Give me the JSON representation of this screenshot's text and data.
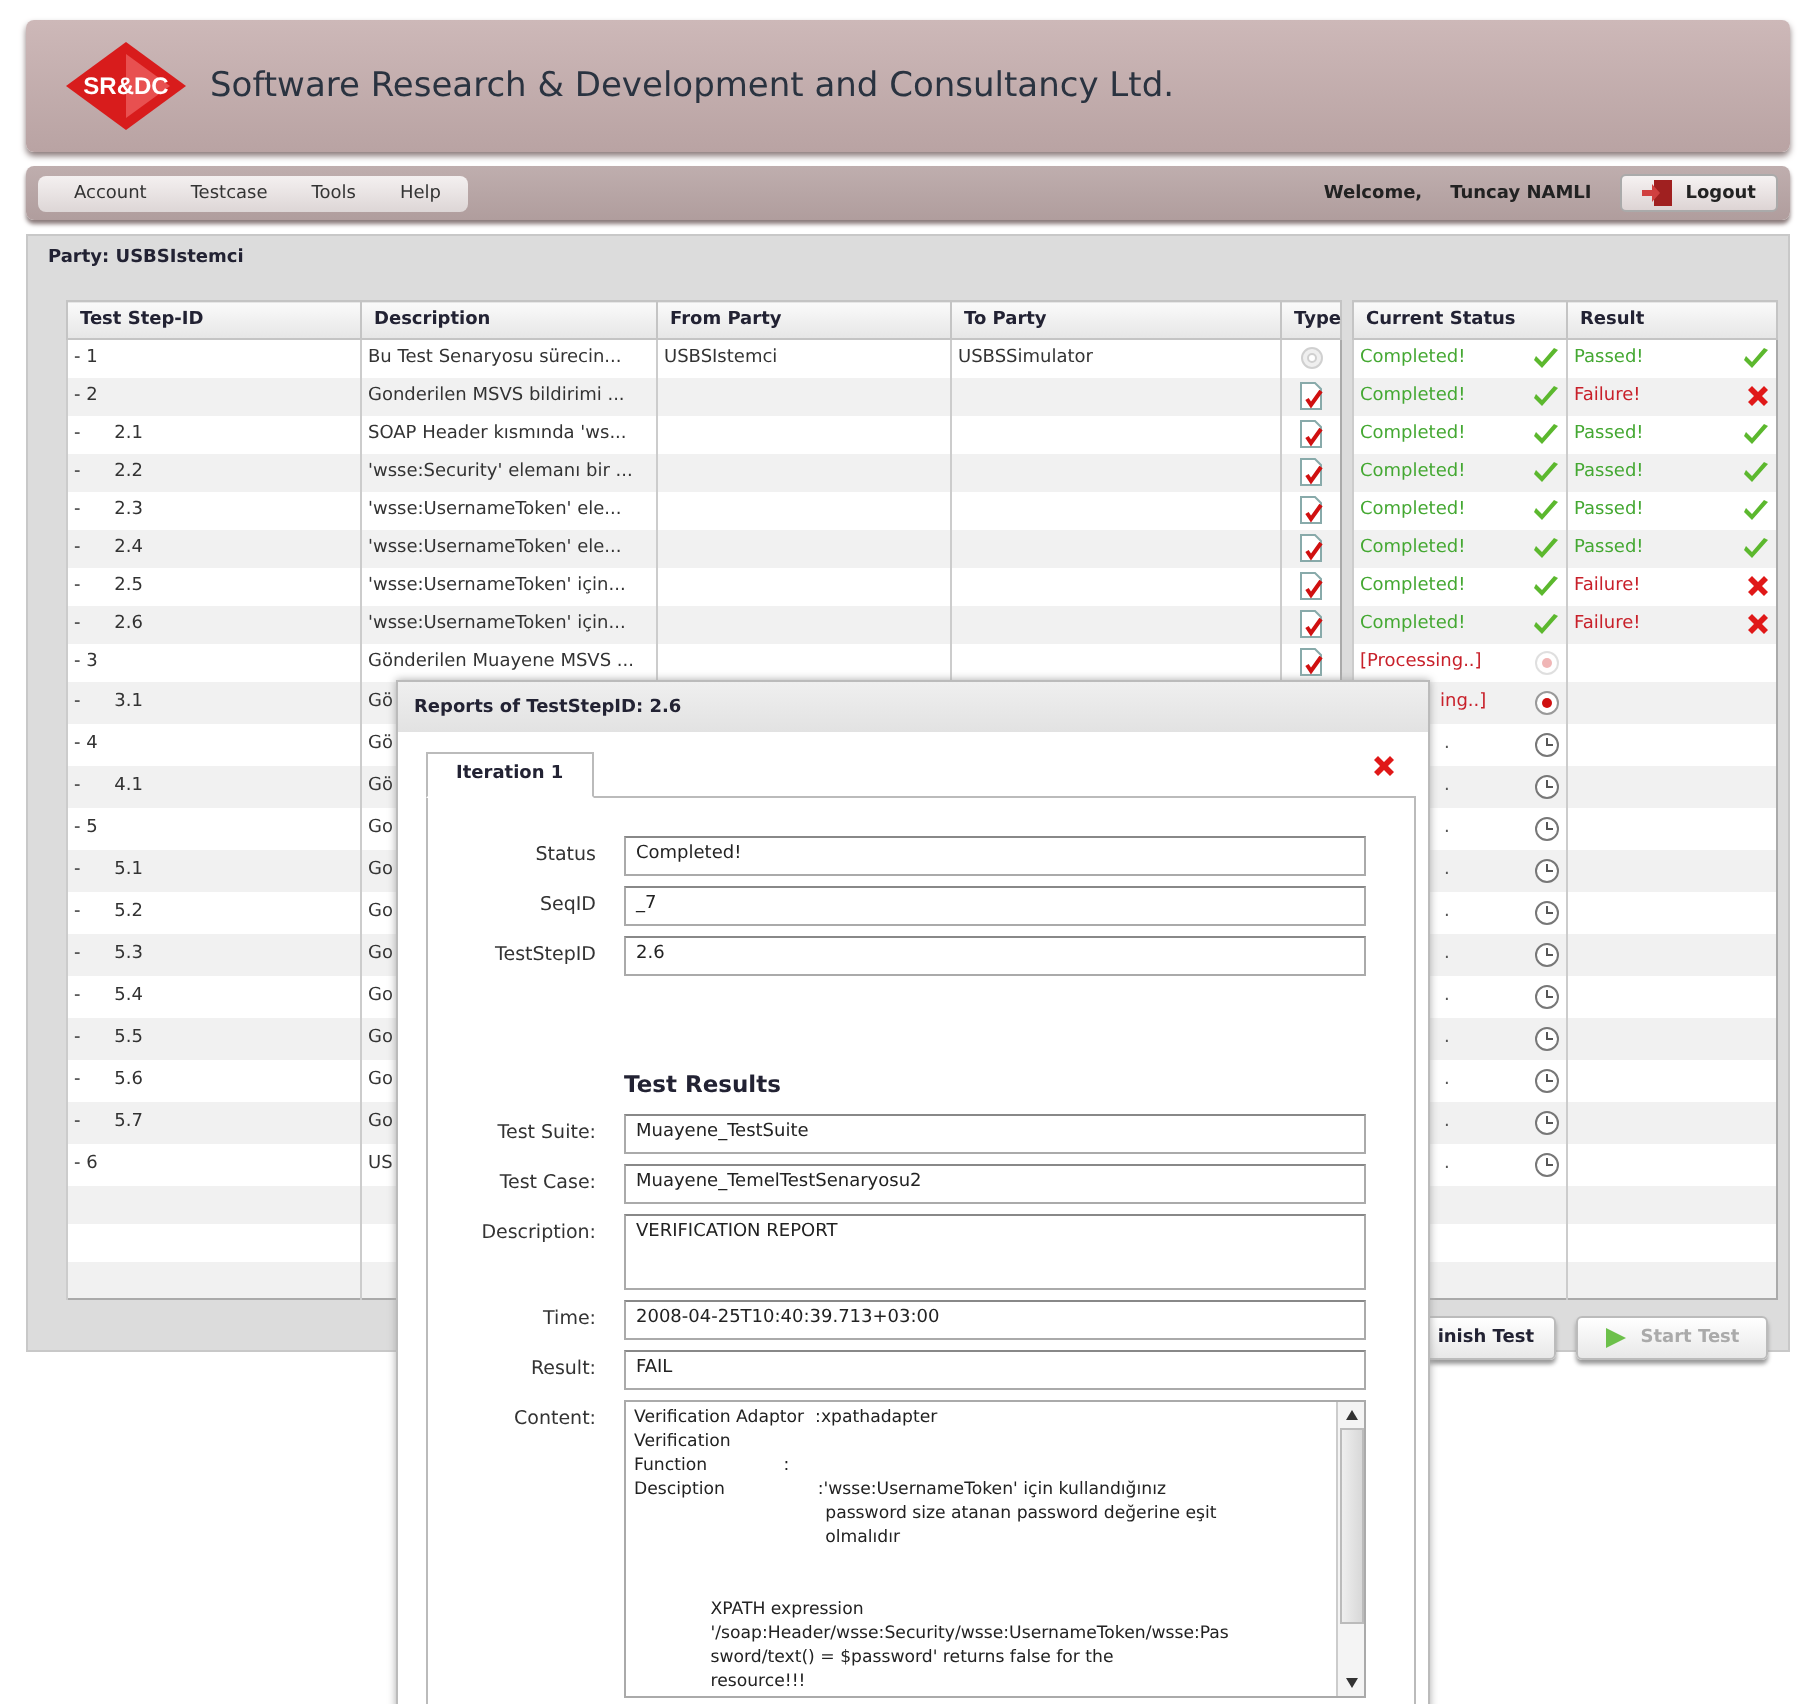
{
  "header": {
    "logo": "SR&DC",
    "title": "Software Research & Development and Consultancy Ltd."
  },
  "menu": [
    "Account",
    "Testcase",
    "Tools",
    "Help"
  ],
  "user": {
    "welcome": "Welcome,",
    "name": "Tuncay NAMLI",
    "logout": "Logout"
  },
  "party": "Party: USBSIstemci",
  "steps_table": {
    "columns": [
      "Test Step-ID",
      "Description",
      "From Party",
      "To Party",
      "Type"
    ],
    "status_columns": [
      "Current Status",
      "Result"
    ],
    "rows": [
      {
        "marker": "-",
        "id": "1",
        "description": "Bu Test Senaryosu sürecin...",
        "from": "USBSIstemci",
        "to": "USBSSimulator",
        "kind": "service",
        "covered": false,
        "status": {
          "text": "Completed!",
          "kind": "completed"
        },
        "result": {
          "text": "Passed!",
          "kind": "passed"
        }
      },
      {
        "marker": "-",
        "id": "2",
        "description": "Gonderilen MSVS bildirimi ...",
        "kind": "document",
        "covered": false,
        "status": {
          "text": "Completed!",
          "kind": "completed"
        },
        "result": {
          "text": "Failure!",
          "kind": "failure"
        },
        "children": [
          {
            "marker": "-",
            "id": "2.1",
            "description": "SOAP Header kısmında 'ws...",
            "kind": "document",
            "covered": false,
            "status": {
              "text": "Completed!",
              "kind": "completed"
            },
            "result": {
              "text": "Passed!",
              "kind": "passed"
            }
          },
          {
            "marker": "-",
            "id": "2.2",
            "description": "'wsse:Security' elemanı bir ...",
            "kind": "document",
            "covered": false,
            "status": {
              "text": "Completed!",
              "kind": "completed"
            },
            "result": {
              "text": "Passed!",
              "kind": "passed"
            }
          },
          {
            "marker": "-",
            "id": "2.3",
            "description": "'wsse:UsernameToken' ele...",
            "kind": "document",
            "covered": false,
            "status": {
              "text": "Completed!",
              "kind": "completed"
            },
            "result": {
              "text": "Passed!",
              "kind": "passed"
            }
          },
          {
            "marker": "-",
            "id": "2.4",
            "description": "'wsse:UsernameToken' ele...",
            "kind": "document",
            "covered": false,
            "status": {
              "text": "Completed!",
              "kind": "completed"
            },
            "result": {
              "text": "Passed!",
              "kind": "passed"
            }
          },
          {
            "marker": "-",
            "id": "2.5",
            "description": "'wsse:UsernameToken' için...",
            "kind": "document",
            "covered": false,
            "status": {
              "text": "Completed!",
              "kind": "completed"
            },
            "result": {
              "text": "Failure!",
              "kind": "failure"
            }
          },
          {
            "marker": "-",
            "id": "2.6",
            "description": "'wsse:UsernameToken' için...",
            "kind": "document",
            "covered": false,
            "status": {
              "text": "Completed!",
              "kind": "completed"
            },
            "result": {
              "text": "Failure!",
              "kind": "failure"
            }
          }
        ]
      },
      {
        "marker": "-",
        "id": "3",
        "description": "Gönderilen Muayene MSVS ...",
        "kind": "document",
        "covered": false,
        "status": {
          "text": "[Processing..]",
          "kind": "pending"
        },
        "children": [
          {
            "marker": "-",
            "id": "3.1",
            "description": "Gö",
            "covered": true,
            "status": {
              "text": "ing..]",
              "kind": "processing"
            }
          }
        ]
      },
      {
        "marker": "-",
        "id": "4",
        "description": "Gö",
        "covered": true,
        "status": {
          "text": ".",
          "kind": "waiting"
        },
        "children": [
          {
            "marker": "-",
            "id": "4.1",
            "description": "Gö",
            "covered": true,
            "status": {
              "text": ".",
              "kind": "waiting"
            }
          }
        ]
      },
      {
        "marker": "-",
        "id": "5",
        "description": "Go",
        "covered": true,
        "status": {
          "text": ".",
          "kind": "waiting"
        },
        "children": [
          {
            "marker": "-",
            "id": "5.1",
            "description": "Go",
            "covered": true,
            "status": {
              "text": ".",
              "kind": "waiting"
            }
          },
          {
            "marker": "-",
            "id": "5.2",
            "description": "Go",
            "covered": true,
            "status": {
              "text": ".",
              "kind": "waiting"
            }
          },
          {
            "marker": "-",
            "id": "5.3",
            "description": "Go",
            "covered": true,
            "status": {
              "text": ".",
              "kind": "waiting"
            }
          },
          {
            "marker": "-",
            "id": "5.4",
            "description": "Go",
            "covered": true,
            "status": {
              "text": ".",
              "kind": "waiting"
            }
          },
          {
            "marker": "-",
            "id": "5.5",
            "description": "Go",
            "covered": true,
            "status": {
              "text": ".",
              "kind": "waiting"
            }
          },
          {
            "marker": "-",
            "id": "5.6",
            "description": "Go",
            "covered": true,
            "status": {
              "text": ".",
              "kind": "waiting"
            }
          },
          {
            "marker": "-",
            "id": "5.7",
            "description": "Go",
            "covered": true,
            "status": {
              "text": ".",
              "kind": "waiting"
            }
          }
        ]
      },
      {
        "marker": "-",
        "id": "6",
        "description": "US",
        "covered": true,
        "status": {
          "text": ".",
          "kind": "waiting"
        }
      }
    ]
  },
  "buttons": [
    {
      "label": "inish Test",
      "kind": "finish",
      "covered": true
    },
    {
      "label": "Start Test",
      "kind": "start",
      "covered": false
    }
  ],
  "dialog": {
    "title": "Reports of TestStepID: 2.6",
    "tabs": [
      {
        "label": "Iteration 1",
        "selected": true
      }
    ],
    "fields": [
      {
        "label": "Status",
        "value": "Completed!"
      },
      {
        "label": "SeqID",
        "value": "_7"
      },
      {
        "label": "TestStepID",
        "value": "2.6"
      }
    ],
    "results_title": "Test Results",
    "results": [
      {
        "label": "Test Suite:",
        "value": "Muayene_TestSuite",
        "kind": "input"
      },
      {
        "label": "Test Case:",
        "value": "Muayene_TemelTestSenaryosu2",
        "kind": "input"
      },
      {
        "label": "Description:",
        "value": "VERIFICATION REPORT",
        "kind": "area"
      },
      {
        "label": "Time:",
        "value": "2008-04-25T10:40:39.713+03:00",
        "kind": "input"
      },
      {
        "label": "Result:",
        "value": "FAIL",
        "kind": "input"
      }
    ],
    "content_label": "Content:",
    "content": "Verification Adaptor  :xpathadapter\nVerification\nFunction              :\nDesciption                 :'wsse:UsernameToken' için kullandığınız\n                                   password size atanan password değerine eşit\n                                   olmalıdır\n\n\n              XPATH expression\n              '/soap:Header/wsse:Security/wsse:UsernameToken/wsse:Pas\n              sword/text() = $password' returns false for the\n              resource!!!"
  }
}
